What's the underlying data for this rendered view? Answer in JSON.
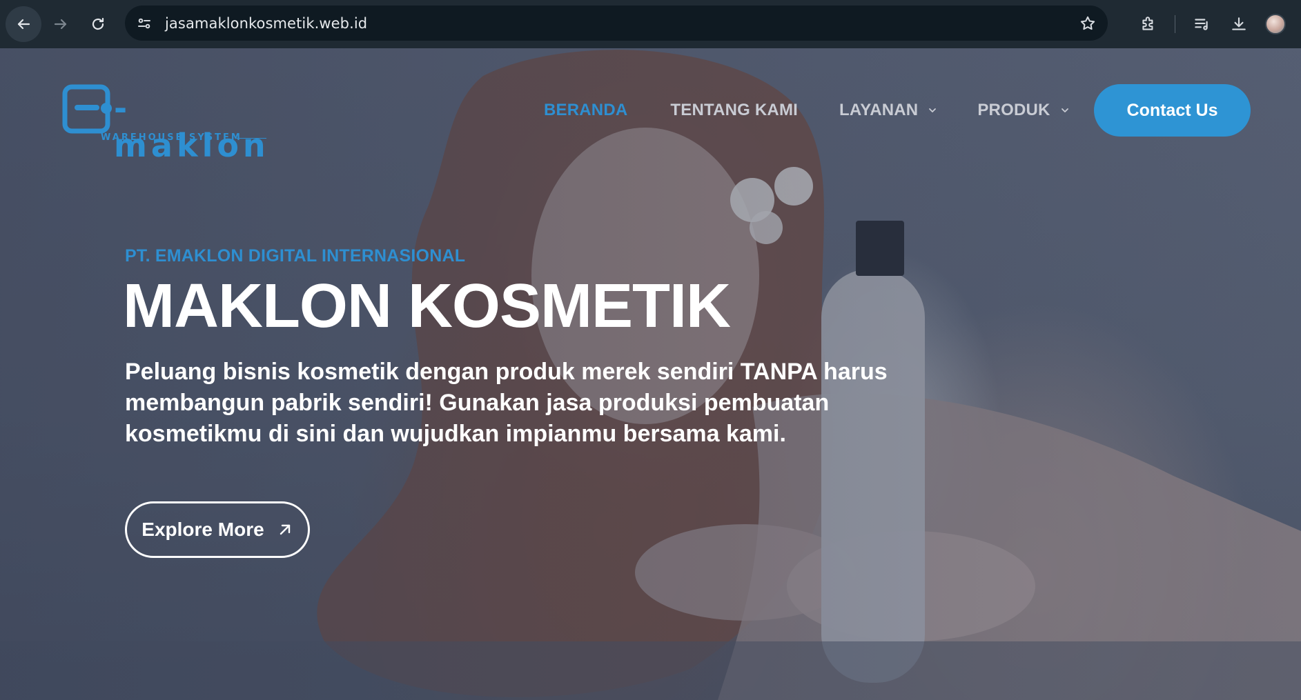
{
  "browser": {
    "url": "jasamaklonkosmetik.web.id",
    "icons": [
      "back-arrow-icon",
      "forward-arrow-icon",
      "reload-icon",
      "site-settings-icon",
      "bookmark-star-icon",
      "extensions-icon",
      "reading-list-icon",
      "download-icon",
      "profile-avatar"
    ]
  },
  "site": {
    "logo": {
      "word": "-maklon",
      "tagline": "WAREHOUSE SYSTEM"
    },
    "nav": [
      {
        "label": "BERANDA",
        "active": true
      },
      {
        "label": "TENTANG KAMI",
        "active": false
      },
      {
        "label": "LAYANAN",
        "active": false,
        "dropdown": true
      },
      {
        "label": "PRODUK",
        "active": false,
        "dropdown": true
      }
    ],
    "contact_label": "Contact Us"
  },
  "hero": {
    "eyebrow": "PT. EMAKLON DIGITAL INTERNASIONAL",
    "title": "MAKLON KOSMETIK",
    "description": "Peluang bisnis kosmetik dengan produk merek sendiri TANPA harus membangun pabrik sendiri! Gunakan jasa produksi pembuatan kosmetikmu di sini dan wujudkan impianmu bersama kami.",
    "cta_label": "Explore More"
  },
  "colors": {
    "accent": "#2e8fd1",
    "chrome_bg": "#1f2a33",
    "omnibox_bg": "#0f1a22"
  }
}
